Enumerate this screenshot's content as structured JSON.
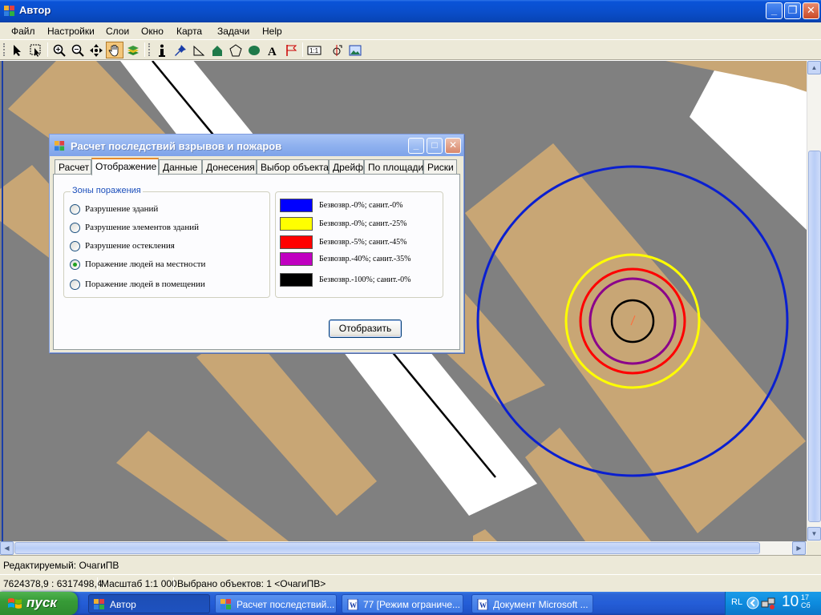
{
  "app": {
    "title": "Автор",
    "menu": [
      "Файл",
      "Настройки",
      "Слои",
      "Окно",
      "Карта",
      "Задачи",
      "Help"
    ]
  },
  "dialog": {
    "title": "Расчет последствий взрывов и пожаров",
    "tabs": [
      "Расчет",
      "Отображение",
      "Данные",
      "Донесения",
      "Выбор объекта",
      "Дрейф",
      "По площади",
      "Риски"
    ],
    "active_tab": "Отображение",
    "group_title": "Зоны поражения",
    "radio_options": [
      {
        "label": "Разрушение зданий",
        "checked": false
      },
      {
        "label": "Разрушение элементов зданий",
        "checked": false
      },
      {
        "label": "Разрушение остекления",
        "checked": false
      },
      {
        "label": "Поражение людей на местности",
        "checked": true
      },
      {
        "label": "Поражение людей в помещении",
        "checked": false
      }
    ],
    "legend": [
      {
        "color": "#0000ff",
        "label": "Безвозвр.-0%; санит.-0%"
      },
      {
        "color": "#ffff00",
        "label": "Безвозвр.-0%; санит.-25%"
      },
      {
        "color": "#ff0000",
        "label": "Безвозвр.-5%; санит.-45%"
      },
      {
        "color": "#c000c0",
        "label": "Безвозвр.-40%; санит.-35%"
      },
      {
        "color": "#000000",
        "label": "Безвозвр.-100%; санит.-0%"
      }
    ],
    "show_button": "Отобразить"
  },
  "map": {
    "zone_colors": [
      "#0a1fd0",
      "#ffff00",
      "#ff0000",
      "#8b008b",
      "#000000"
    ],
    "building_color": "#c8a675",
    "background_color": "#808080"
  },
  "status": {
    "editable": "Редактируемый: ОчагиПВ",
    "coordinates": "7624378,9 : 6317498,4",
    "scale": "Масштаб 1:1 000",
    "selected": "Выбрано объектов: 1 <ОчагиПВ>"
  },
  "taskbar": {
    "start": "пуск",
    "tasks": [
      {
        "label": "Автор",
        "active": true
      },
      {
        "label": "Расчет последствий...",
        "active": false
      },
      {
        "label": "77 [Режим ограниче...",
        "active": false
      },
      {
        "label": "Документ Microsoft ...",
        "active": false
      }
    ],
    "lang": "RL",
    "clock_hour": "10",
    "clock_minutes": "17",
    "clock_day": "Сб"
  }
}
